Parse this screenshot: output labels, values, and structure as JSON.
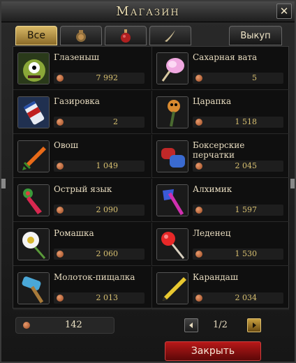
{
  "window": {
    "title": "Магазин"
  },
  "tabs": [
    {
      "label": "Все",
      "icon": "all-tab",
      "active": true
    },
    {
      "label": "",
      "icon": "vase-icon",
      "active": false
    },
    {
      "label": "",
      "icon": "potion-icon",
      "active": false
    },
    {
      "label": "",
      "icon": "horn-icon",
      "active": false
    }
  ],
  "buyback": {
    "label": "Выкуп"
  },
  "items": [
    {
      "name": "Глазеныш",
      "price": "7 992",
      "icon": "one-eyed-monster-icon"
    },
    {
      "name": "Сахарная вата",
      "price": "5",
      "icon": "cotton-candy-icon"
    },
    {
      "name": "Газировка",
      "price": "2",
      "icon": "soda-can-icon"
    },
    {
      "name": "Царапка",
      "price": "1 518",
      "icon": "claw-staff-icon"
    },
    {
      "name": "Овош",
      "price": "1 049",
      "icon": "carrot-sword-icon"
    },
    {
      "name": "Боксерские перчатки",
      "price": "2 045",
      "icon": "boxing-gloves-icon"
    },
    {
      "name": "Острый язык",
      "price": "2 090",
      "icon": "tongue-icon"
    },
    {
      "name": "Алхимик",
      "price": "1 597",
      "icon": "axe-icon"
    },
    {
      "name": "Ромашка",
      "price": "2 060",
      "icon": "daisy-icon"
    },
    {
      "name": "Леденец",
      "price": "1 530",
      "icon": "lollipop-icon"
    },
    {
      "name": "Молоток-пищалка",
      "price": "2 013",
      "icon": "squeaky-hammer-icon"
    },
    {
      "name": "Карандаш",
      "price": "2 034",
      "icon": "pencil-icon"
    }
  ],
  "balance": {
    "value": "142"
  },
  "pagination": {
    "label": "1/2"
  },
  "close_action": {
    "label": "Закрыть"
  },
  "colors": {
    "price": "#d8c070",
    "coin": "#c06a3a",
    "close_button": "#9a1010",
    "active_tab": "#c8a04a"
  }
}
